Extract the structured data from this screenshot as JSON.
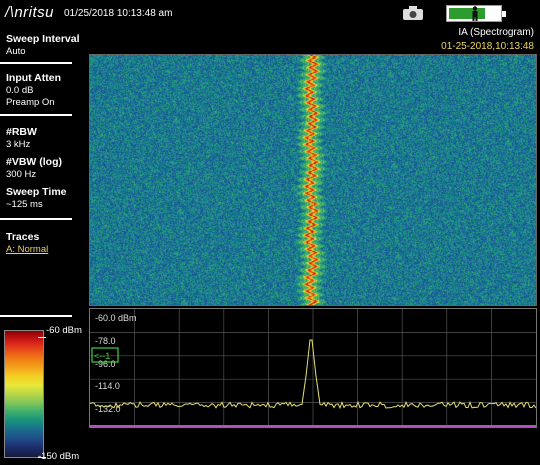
{
  "header": {
    "brand": "/\\nritsu",
    "datetime": "01/25/2018 10:13:48 am"
  },
  "mode_panel": {
    "mode": "IA (Spectrogram)",
    "timestamp": "01-25-2018,10:13:48"
  },
  "settings": {
    "sweep_interval_title": "Sweep Interval",
    "sweep_interval_value": "Auto",
    "input_atten_title": "Input Atten",
    "input_atten_value": "0.0 dB",
    "preamp_value": "Preamp On",
    "rbw_title": "#RBW",
    "rbw_value": "3 kHz",
    "vbw_title": "#VBW (log)",
    "vbw_value": "300 Hz",
    "sweep_time_title": "Sweep Time",
    "sweep_time_value": "~125 ms",
    "traces_title": "Traces",
    "traces_value": "A: Normal"
  },
  "trace_plot": {
    "y_labels": [
      "-60.0 dBm",
      "-78.0",
      "-96.0",
      "-114.0",
      "-132.0"
    ],
    "marker_label": "<--1"
  },
  "color_scale": {
    "top": "-60 dBm",
    "bottom": "-150 dBm"
  },
  "colors": {
    "accent_yellow": "#f0d860",
    "battery_green": "#2e9b2e",
    "trace_yellow": "#e8e070",
    "marker_green": "#3ad13a"
  }
}
